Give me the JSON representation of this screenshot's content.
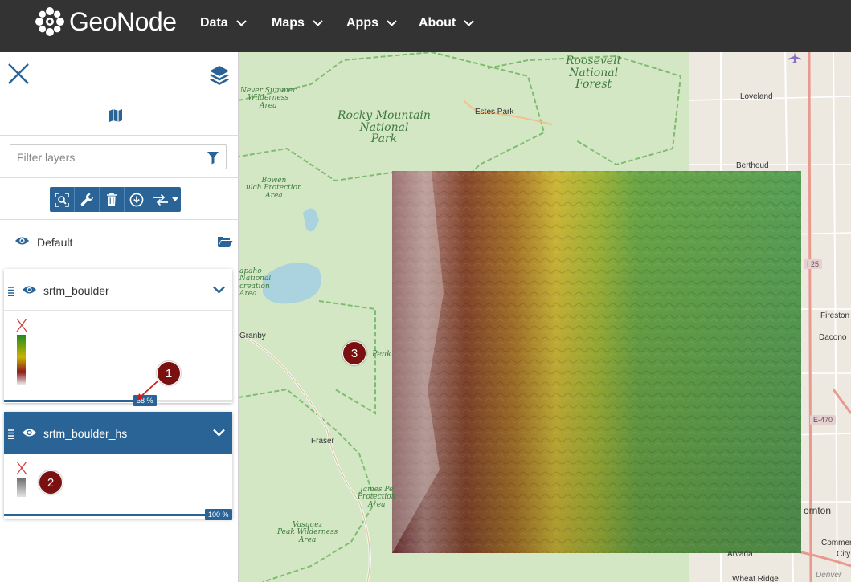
{
  "nav": {
    "brand": "GeoNode",
    "items": [
      {
        "label": "Data"
      },
      {
        "label": "Maps"
      },
      {
        "label": "Apps"
      },
      {
        "label": "About"
      }
    ]
  },
  "panel": {
    "filter_placeholder": "Filter layers",
    "group_label": "Default",
    "layers": [
      {
        "name": "srtm_boulder",
        "opacity": 0.58,
        "opacity_label": "58 %",
        "selected": false
      },
      {
        "name": "srtm_boulder_hs",
        "opacity": 1.0,
        "opacity_label": "100 %",
        "selected": true
      }
    ]
  },
  "callouts": [
    "1",
    "2",
    "3"
  ],
  "map": {
    "areas": [
      {
        "name": "Roosevelt National Forest",
        "lines": [
          "Roosevelt",
          "National",
          "Forest"
        ]
      },
      {
        "name": "Rocky Mountain National Park",
        "lines": [
          "Rocky Mountain",
          "National",
          "Park"
        ]
      },
      {
        "name": "Never Summer Wilderness Area",
        "lines": [
          "Never Summer",
          "Wilderness",
          "Area"
        ]
      },
      {
        "name": "Bowen Gulch Protection Area",
        "lines": [
          "Bowen",
          "ulch Protection",
          "Area"
        ]
      },
      {
        "name": "Arapaho National Recreation Area",
        "lines": [
          "apaho",
          "National",
          "creation",
          "Area"
        ]
      },
      {
        "name": "James Peak Protection Area",
        "lines": [
          "James Pe",
          "Protection",
          "Area"
        ]
      },
      {
        "name": "Vasquez Peak Wilderness Area",
        "lines": [
          "Vasquez",
          "Peak Wilderness",
          "Area"
        ]
      },
      {
        "name": "Peak",
        "lines": [
          "Peak"
        ]
      }
    ],
    "towns": [
      "Estes Park",
      "Loveland",
      "Berthoud",
      "Granby",
      "Fraser",
      "Fireston",
      "Dacono",
      "Arvada",
      "Wheat Ridge",
      "ornton",
      "Commer",
      "City",
      "Denver"
    ],
    "roads": [
      "I 25",
      "E-470"
    ]
  },
  "colors": {
    "navbar": "#333333",
    "primary": "#2a6496",
    "callout": "#7a1010"
  }
}
